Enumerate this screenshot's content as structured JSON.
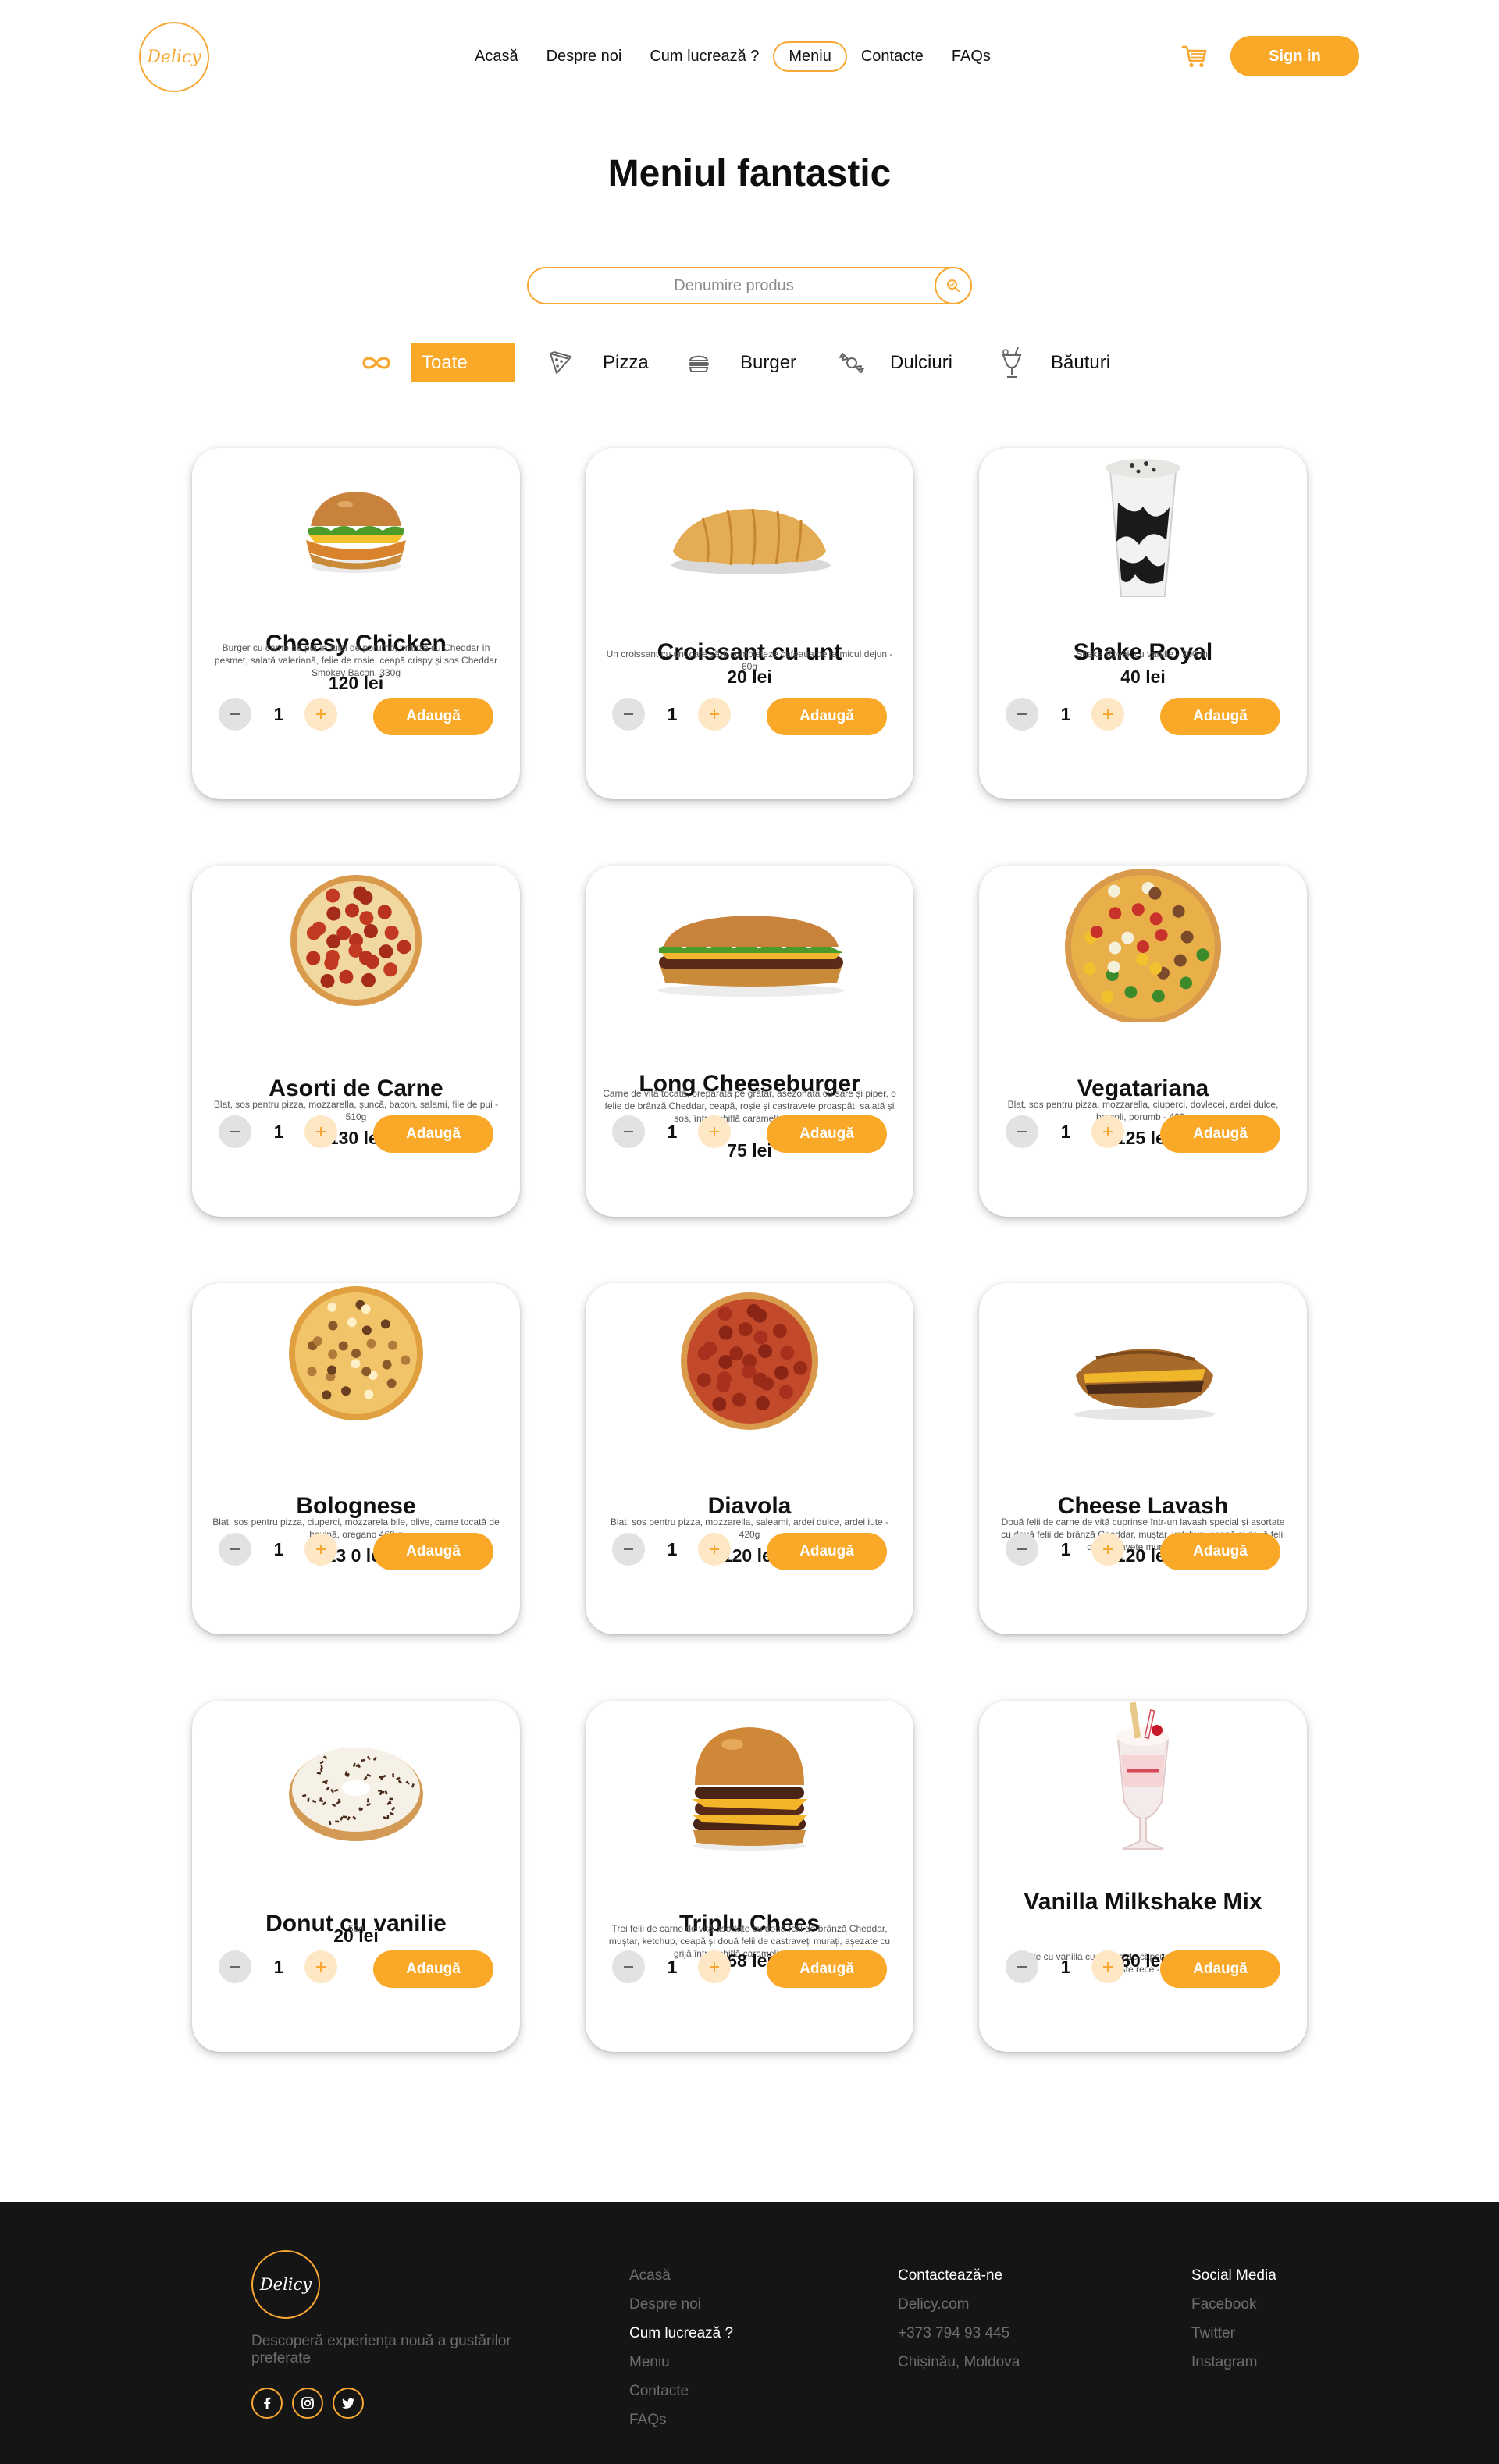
{
  "brand": {
    "logo_text": "Delicy"
  },
  "nav": {
    "items": [
      "Acasă",
      "Despre noi",
      "Cum lucrează ?",
      "Meniu",
      "Contacte",
      "FAQs"
    ],
    "active": "Meniu",
    "signin_label": "Sign in"
  },
  "page": {
    "title": "Meniul fantastic"
  },
  "search": {
    "placeholder": "Denumire produs",
    "value": ""
  },
  "categories": [
    {
      "label": "Toate",
      "icon": "infinity-icon",
      "active": true
    },
    {
      "label": "Pizza",
      "icon": "pizza-icon",
      "active": false
    },
    {
      "label": "Burger",
      "icon": "burger-icon",
      "active": false
    },
    {
      "label": "Dulciuri",
      "icon": "candy-icon",
      "active": false
    },
    {
      "label": "Băuturi",
      "icon": "drink-icon",
      "active": false
    }
  ],
  "add_label": "Adaugă",
  "products": [
    {
      "name": "Cheesy Chicken",
      "desc": "Burger cu carne de pui în fulgi de porumb, brânză cu Cheddar în pesmet, salată valeriană, felie de roșie, ceapă crispy și sos Cheddar Smokey Bacon. 330g",
      "price": "120 lei",
      "qty": "1",
      "img": "chicken-burger"
    },
    {
      "name": "Croissant cu unt",
      "desc": "Un croissant cu unt care să-ți completeze cafeaua de la micul dejun - 60g",
      "price": "20 lei",
      "qty": "1",
      "img": "croissant"
    },
    {
      "name": "Shake Royal",
      "desc": "Shake Royak cu vanilie - 300 ml",
      "price": "40 lei",
      "qty": "1",
      "img": "shake-cup"
    },
    {
      "name": "Asorti de Carne",
      "desc": "Blat, sos pentru pizza, mozzarella, șuncă, bacon, salami, file de pui - 510g",
      "price": "130 lei",
      "qty": "1",
      "img": "pizza-pepperoni"
    },
    {
      "name": "Long Cheeseburger",
      "desc": "Carne de vită tocată, preparată pe grătar, asezonată cu sare și piper, o felie de brânză Cheddar, ceapă, roșie și castravete proaspăt, salată și sos, într-o chiflă caramelizată - 140g",
      "price": "75 lei",
      "qty": "1",
      "img": "long-burger"
    },
    {
      "name": "Vegatariana",
      "desc": "Blat, sos pentru pizza, mozzarella, ciuperci, dovlecei, ardei dulce, brocoli, porumb - 460g",
      "price": "125 lei",
      "qty": "1",
      "img": "pizza-veggie"
    },
    {
      "name": "Bolognese",
      "desc": "Blat, sos pentru pizza, ciuperci, mozzarela bile, olive, carne tocată de bovină, oregano 460 g",
      "price": "13 0 lei",
      "qty": "1",
      "img": "pizza-bolognese"
    },
    {
      "name": "Diavola",
      "desc": "Blat, sos pentru pizza, mozzarella, saleami, ardei dulce, ardei iute - 420g",
      "price": "120 lei",
      "qty": "1",
      "img": "pizza-diavola"
    },
    {
      "name": "Cheese Lavash",
      "desc": "Două felii de carne de vită cuprinse într-un lavash special și asortate cu două felii de brânză Cheddar, muștar, ketchup, ceapă și două felii de castravete murat - 165g",
      "price": "120 lei",
      "qty": "1",
      "img": "lavash"
    },
    {
      "name": "Donut cu vanilie",
      "desc": "50g",
      "price": "20 lei",
      "qty": "1",
      "img": "donut"
    },
    {
      "name": "Triplu Chees",
      "desc": "Trei felii de carne de vită asortate cu două felii de brânză Cheddar, muștar, ketchup, ceapă și două felii de castraveți murați, așezate cu grijă într-o chiflă caramelizată - 216g",
      "price": "68 lei",
      "qty": "1",
      "img": "triple-burger"
    },
    {
      "name": "Vanilla Milkshake Mix",
      "desc": "Shake cu vanilla cu aroma de căpșune si o textura ușoară. Se serveste rece - 400ml",
      "price": "60 lei",
      "qty": "1",
      "img": "milkshake-glass"
    }
  ],
  "footer": {
    "logo_text": "Delicy",
    "tagline": "Descoperă experiența nouă a gustărilor preferate",
    "nav_links": [
      "Acasă",
      "Despre noi",
      "Cum  lucrează ?",
      "Meniu",
      "Contacte",
      "FAQs"
    ],
    "nav_highlight": "Cum  lucrează ?",
    "contact_title": "Contactează-ne",
    "contact": [
      "Delicy.com",
      "+373 794 93 445",
      "Chișinău, Moldova"
    ],
    "social_title": "Social Media",
    "social": [
      "Facebook",
      "Twitter",
      "Instagram"
    ],
    "social_icons": [
      "facebook-icon",
      "instagram-icon",
      "twitter-icon"
    ]
  },
  "colors": {
    "accent": "#f9a828",
    "footer_bg": "#161515"
  }
}
